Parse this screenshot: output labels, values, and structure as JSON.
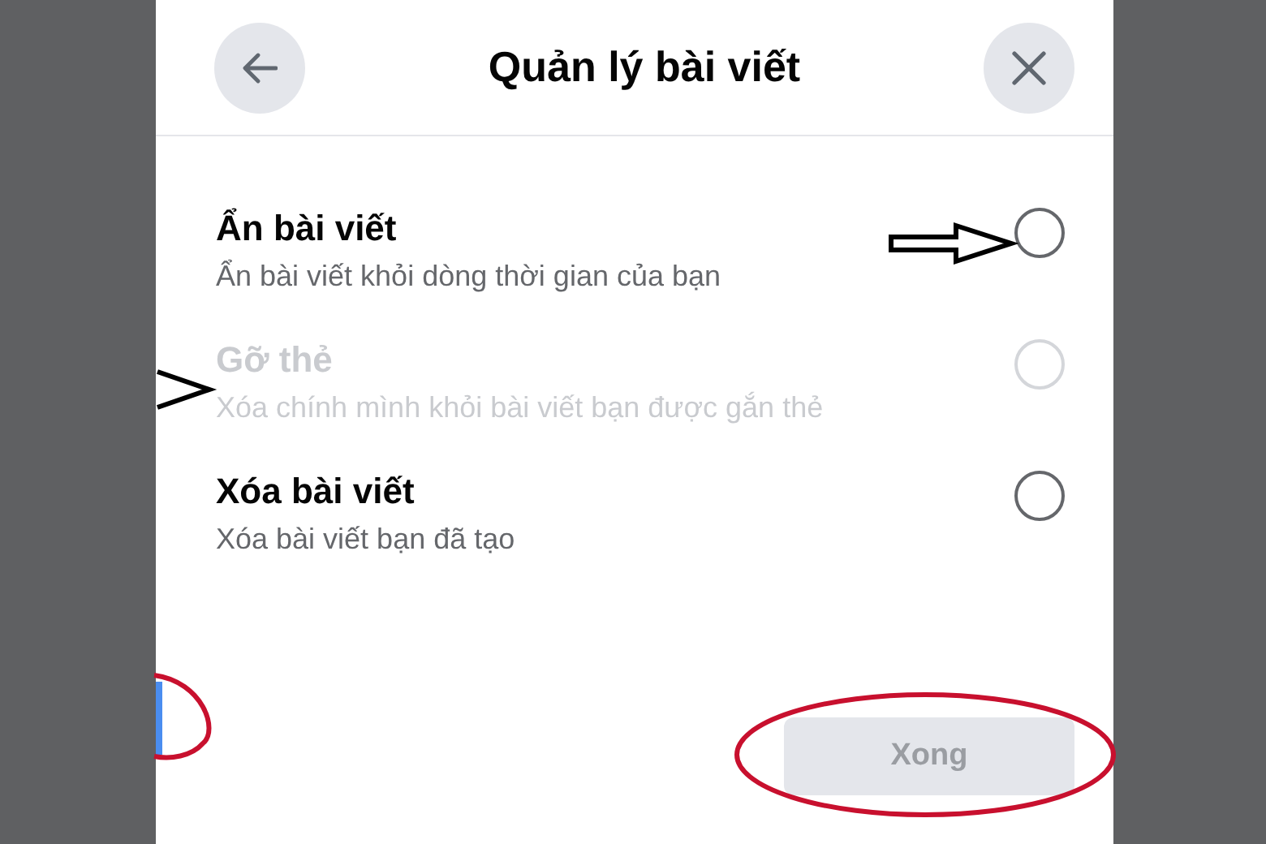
{
  "header": {
    "title": "Quản lý bài viết"
  },
  "options": [
    {
      "title": "Ẩn bài viết",
      "description": "Ẩn bài viết khỏi dòng thời gian của bạn",
      "disabled": false,
      "selected": false
    },
    {
      "title": "Gỡ thẻ",
      "description": "Xóa chính mình khỏi bài viết bạn được gắn thẻ",
      "disabled": true,
      "selected": false
    },
    {
      "title": "Xóa bài viết",
      "description": "Xóa bài viết bạn đã tạo",
      "disabled": false,
      "selected": false
    }
  ],
  "done_button": {
    "label": "Xong",
    "disabled": true
  }
}
